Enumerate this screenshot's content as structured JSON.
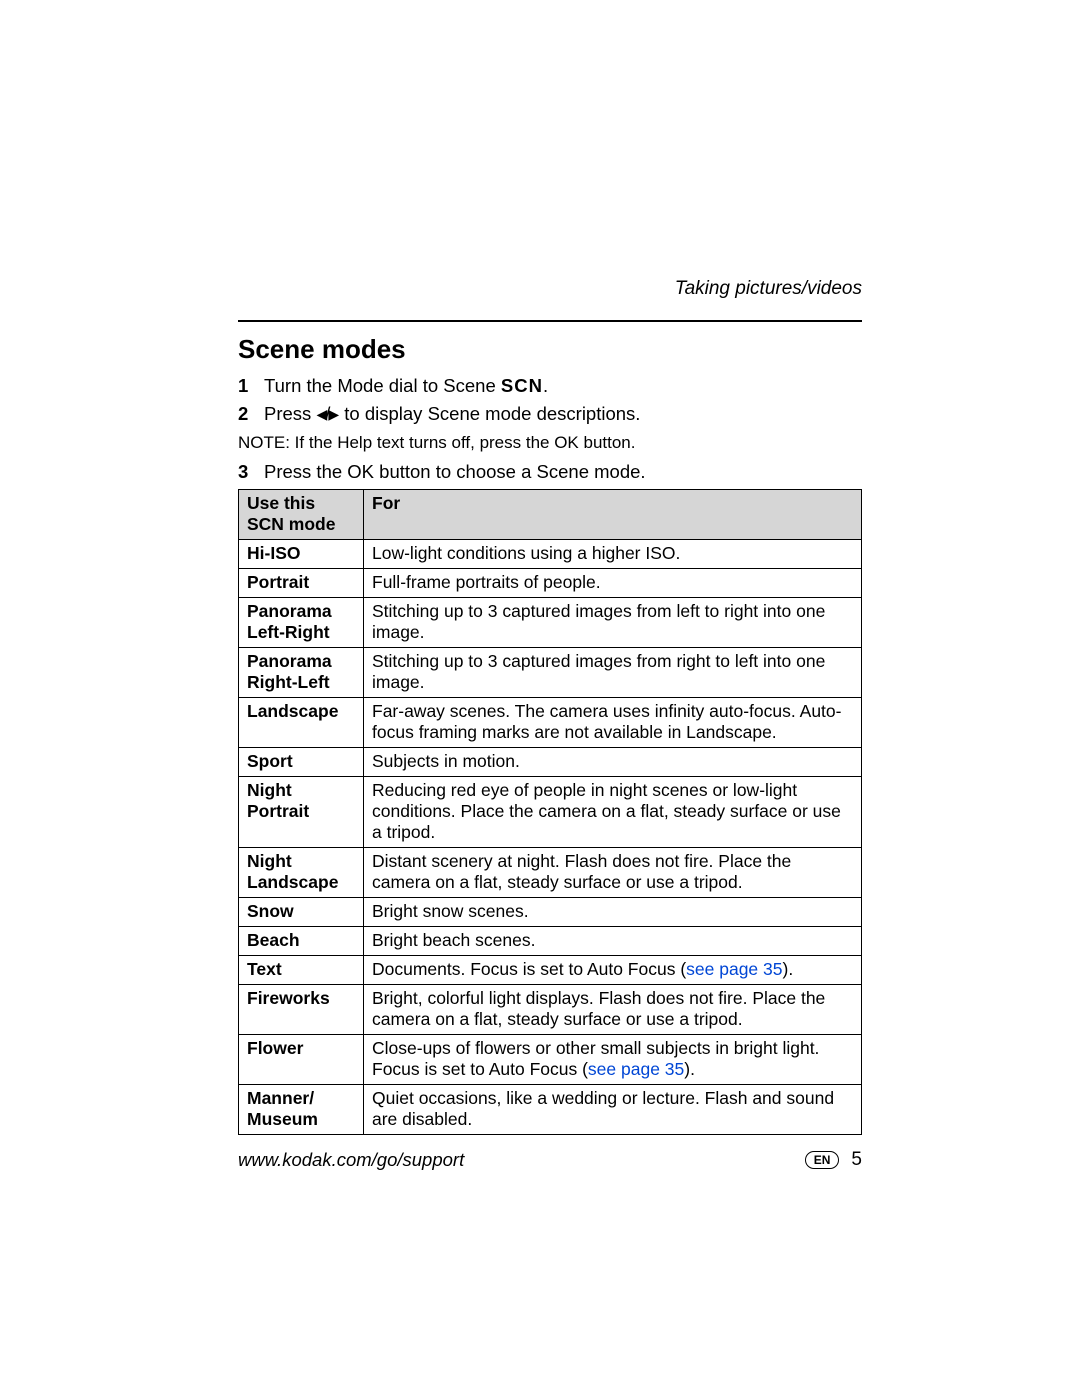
{
  "header": {
    "running_head": "Taking pictures/videos"
  },
  "section": {
    "title": "Scene modes",
    "steps": {
      "s1_num": "1",
      "s1_a": "Turn the Mode dial to Scene ",
      "s1_scn": "SCN",
      "s1_b": ".",
      "s2_num": "2",
      "s2_a": "Press ",
      "s2_b": " to display Scene mode descriptions.",
      "note_label": "NOTE:  ",
      "note_text": "If the Help text turns off, press the OK button.",
      "s3_num": "3",
      "s3_text": "Press the OK button to choose a Scene mode."
    }
  },
  "table": {
    "head_mode_l1": "Use this",
    "head_mode_l2": "SCN mode",
    "head_for": "For",
    "rows": [
      {
        "mode_l1": "Hi-ISO",
        "mode_l2": "",
        "desc_a": "Low-light conditions using a higher ISO.",
        "link": "",
        "desc_b": ""
      },
      {
        "mode_l1": "Portrait",
        "mode_l2": "",
        "desc_a": "Full-frame portraits of people.",
        "link": "",
        "desc_b": ""
      },
      {
        "mode_l1": "Panorama",
        "mode_l2": "Left-Right",
        "desc_a": "Stitching up to 3 captured images from left to right into one image.",
        "link": "",
        "desc_b": ""
      },
      {
        "mode_l1": "Panorama",
        "mode_l2": "Right-Left",
        "desc_a": "Stitching up to 3 captured images from right to left into one image.",
        "link": "",
        "desc_b": ""
      },
      {
        "mode_l1": "Landscape",
        "mode_l2": "",
        "desc_a": "Far-away scenes. The camera uses infinity auto-focus. Auto-focus framing marks are not available in Landscape.",
        "link": "",
        "desc_b": ""
      },
      {
        "mode_l1": "Sport",
        "mode_l2": "",
        "desc_a": "Subjects in motion.",
        "link": "",
        "desc_b": ""
      },
      {
        "mode_l1": "Night",
        "mode_l2": "Portrait",
        "desc_a": "Reducing red eye of people in night scenes or low-light conditions. Place the camera on a flat, steady surface or use a tripod.",
        "link": "",
        "desc_b": ""
      },
      {
        "mode_l1": "Night",
        "mode_l2": "Landscape",
        "desc_a": "Distant scenery at night. Flash does not fire. Place the camera on a flat, steady surface or use a tripod.",
        "link": "",
        "desc_b": ""
      },
      {
        "mode_l1": "Snow",
        "mode_l2": "",
        "desc_a": "Bright snow scenes.",
        "link": "",
        "desc_b": ""
      },
      {
        "mode_l1": "Beach",
        "mode_l2": "",
        "desc_a": "Bright beach scenes.",
        "link": "",
        "desc_b": ""
      },
      {
        "mode_l1": "Text",
        "mode_l2": "",
        "desc_a": "Documents. Focus is set to Auto Focus (",
        "link": "see page 35",
        "desc_b": ")."
      },
      {
        "mode_l1": "Fireworks",
        "mode_l2": "",
        "desc_a": "Bright, colorful light displays. Flash does not fire. Place the camera on a flat, steady surface or use a tripod.",
        "link": "",
        "desc_b": ""
      },
      {
        "mode_l1": "Flower",
        "mode_l2": "",
        "desc_a": "Close-ups of flowers or other small subjects in bright light. Focus is set to Auto Focus (",
        "link": "see page 35",
        "desc_b": ")."
      },
      {
        "mode_l1": "Manner/",
        "mode_l2": "Museum",
        "desc_a": "Quiet occasions, like a wedding or lecture. Flash and sound are disabled.",
        "link": "",
        "desc_b": ""
      }
    ]
  },
  "footer": {
    "url": "www.kodak.com/go/support",
    "lang": "EN",
    "page": "5"
  }
}
